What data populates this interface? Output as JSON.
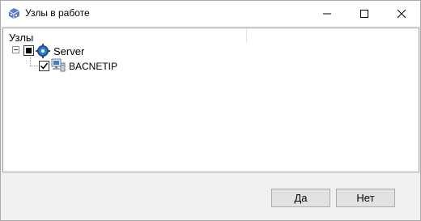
{
  "window": {
    "title": "Узлы в работе",
    "controls": {
      "minimize_icon": "minimize-icon",
      "maximize_icon": "maximize-icon",
      "close_icon": "close-icon"
    }
  },
  "tree": {
    "header": "Узлы",
    "nodes": [
      {
        "label": "Server",
        "state": "partial",
        "icon": "server-gear-icon",
        "expanded": true,
        "children": [
          {
            "label": "BACNETIP",
            "state": "checked",
            "icon": "network-computer-icon"
          }
        ]
      }
    ]
  },
  "buttons": {
    "yes": "Да",
    "no": "Нет"
  },
  "colors": {
    "title_bar": "#ffffff",
    "window_bg": "#f0f0f0",
    "button_bg": "#e1e1e1",
    "button_border": "#adadad"
  }
}
